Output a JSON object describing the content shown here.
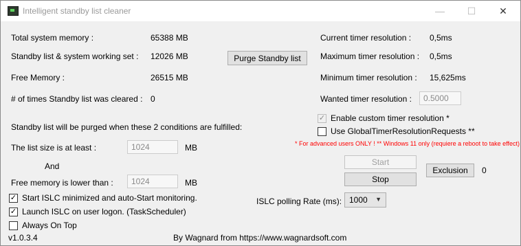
{
  "window": {
    "title": "Intelligent standby list cleaner",
    "minimize_glyph": "—",
    "maximize_glyph": "☐",
    "close_glyph": "✕"
  },
  "memory": {
    "total_label": "Total system memory :",
    "total_value": "65388 MB",
    "standby_label": "Standby list & system working set :",
    "standby_value": "12026 MB",
    "free_label": "Free Memory :",
    "free_value": "26515 MB",
    "cleared_label": "# of times Standby list was cleared :",
    "cleared_value": "0",
    "purge_button": "Purge Standby list"
  },
  "conditions": {
    "heading": "Standby list will be purged when these 2 conditions are fulfilled:",
    "list_size_label": "The list size is at least :",
    "list_size_value": "1024",
    "list_size_unit": "MB",
    "and_label": "And",
    "free_mem_label": "Free memory is lower than :",
    "free_mem_value": "1024",
    "free_mem_unit": "MB"
  },
  "options": {
    "start_minimized": {
      "label": "Start ISLC minimized and auto-Start monitoring.",
      "checked": "✓"
    },
    "launch_logon": {
      "label": "Launch ISLC on user logon. (TaskScheduler)",
      "checked": "✓"
    },
    "always_on_top": {
      "label": "Always On Top",
      "checked": ""
    }
  },
  "timer": {
    "current_label": "Current timer resolution :",
    "current_value": "0,5ms",
    "max_label": "Maximum timer resolution :",
    "max_value": "0,5ms",
    "min_label": "Minimum timer resolution :",
    "min_value": "15,625ms",
    "wanted_label": "Wanted timer resolution :",
    "wanted_value": "0.5000",
    "enable_custom": {
      "label": "Enable custom timer resolution *",
      "checked": "✓"
    },
    "global_requests": {
      "label": "Use GlobalTimerResolutionRequests **",
      "checked": ""
    },
    "warning": "* For advanced users ONLY !  ** Windows 11 only (requiere a reboot to take effect)"
  },
  "controls": {
    "start_button": "Start",
    "stop_button": "Stop",
    "exclusion_button": "Exclusion",
    "exclusion_count": "0",
    "polling_label": "ISLC polling Rate (ms):",
    "polling_value": "1000"
  },
  "footer": {
    "version": "v1.0.3.4",
    "credit": "By Wagnard from https://www.wagnardsoft.com"
  }
}
